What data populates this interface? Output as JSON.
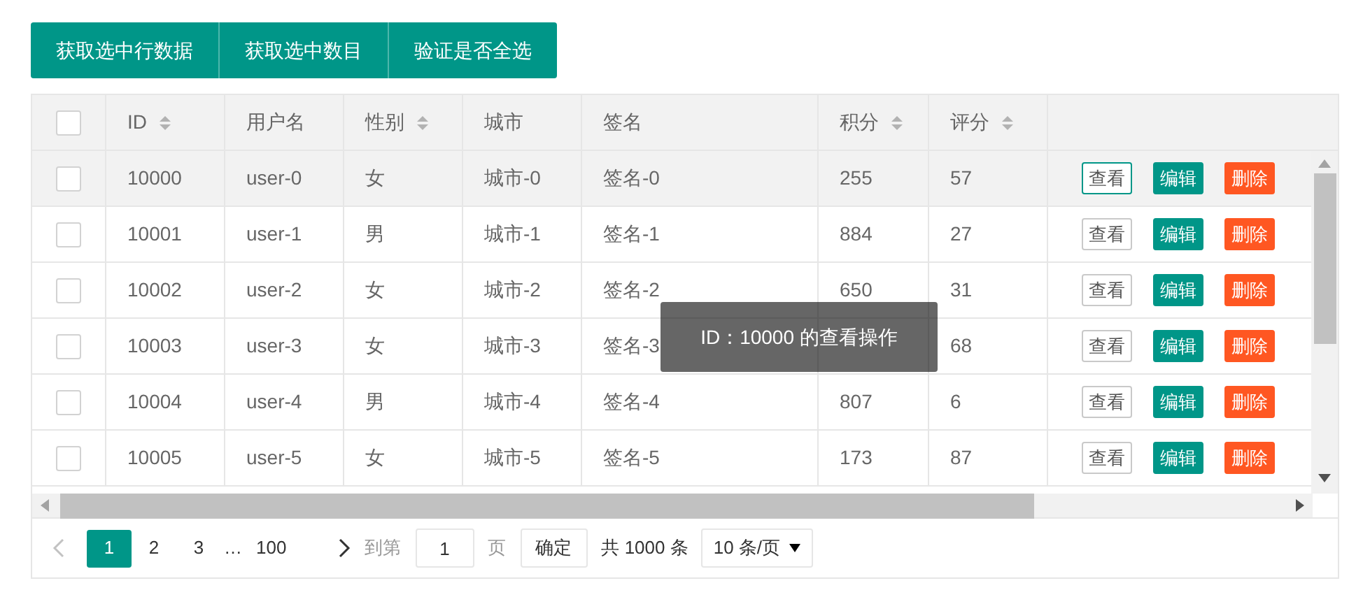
{
  "toolbar": {
    "buttons": [
      "获取选中行数据",
      "获取选中数目",
      "验证是否全选"
    ]
  },
  "table": {
    "header_checkbox": {
      "checked": false
    },
    "columns": [
      {
        "label": "ID",
        "sortable": true
      },
      {
        "label": "用户名",
        "sortable": false
      },
      {
        "label": "性别",
        "sortable": true
      },
      {
        "label": "城市",
        "sortable": false
      },
      {
        "label": "签名",
        "sortable": false
      },
      {
        "label": "积分",
        "sortable": true
      },
      {
        "label": "评分",
        "sortable": true
      }
    ],
    "rows": [
      {
        "checked": false,
        "hovered": true,
        "cells": [
          "10000",
          "user-0",
          "女",
          "城市-0",
          "签名-0",
          "255",
          "57"
        ],
        "actions": [
          "查看",
          "编辑",
          "删除"
        ]
      },
      {
        "checked": false,
        "hovered": false,
        "cells": [
          "10001",
          "user-1",
          "男",
          "城市-1",
          "签名-1",
          "884",
          "27"
        ],
        "actions": [
          "查看",
          "编辑",
          "删除"
        ]
      },
      {
        "checked": false,
        "hovered": false,
        "cells": [
          "10002",
          "user-2",
          "女",
          "城市-2",
          "签名-2",
          "650",
          "31"
        ],
        "actions": [
          "查看",
          "编辑",
          "删除"
        ]
      },
      {
        "checked": false,
        "hovered": false,
        "cells": [
          "10003",
          "user-3",
          "女",
          "城市-3",
          "签名-3",
          null,
          "68"
        ],
        "actions": [
          "查看",
          "编辑",
          "删除"
        ]
      },
      {
        "checked": false,
        "hovered": false,
        "cells": [
          "10004",
          "user-4",
          "男",
          "城市-4",
          "签名-4",
          "807",
          "6"
        ],
        "actions": [
          "查看",
          "编辑",
          "删除"
        ]
      },
      {
        "checked": false,
        "hovered": false,
        "cells": [
          "10005",
          "user-5",
          "女",
          "城市-5",
          "签名-5",
          "173",
          "87"
        ],
        "actions": [
          "查看",
          "编辑",
          "删除"
        ]
      }
    ]
  },
  "tooltip": {
    "text": "ID：10000 的查看操作"
  },
  "pagination": {
    "pages": [
      {
        "label": "1",
        "selected": true
      },
      {
        "label": "2",
        "selected": false
      },
      {
        "label": "3",
        "selected": false
      },
      {
        "label": "…",
        "kind": "ellipsis"
      },
      {
        "label": "100",
        "selected": false
      }
    ],
    "goto_label": "到第",
    "goto_value": "1",
    "page_unit": "页",
    "confirm": "确定",
    "total": "共 1000 条",
    "page_size": "10 条/页"
  }
}
